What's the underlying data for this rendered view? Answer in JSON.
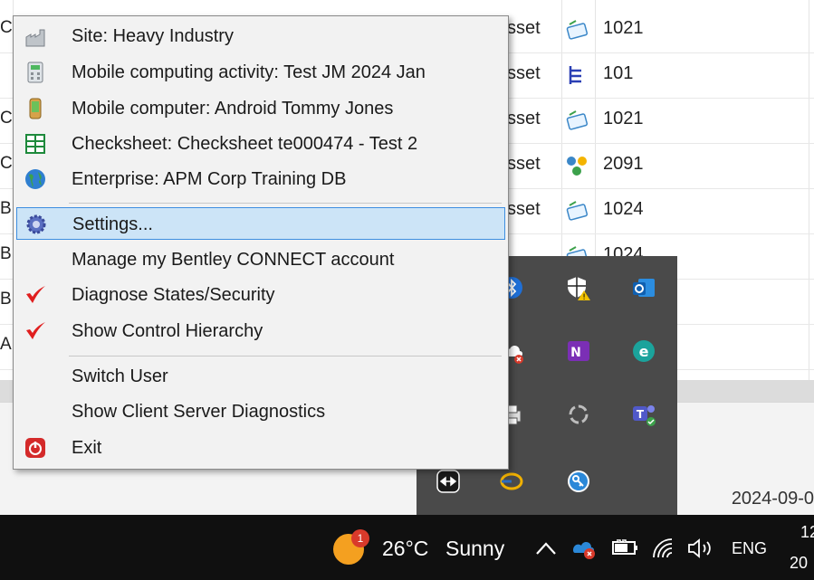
{
  "background_rows": [
    {
      "col0": "CO",
      "col2": "sset",
      "icon": "document-icon",
      "num": "1021"
    },
    {
      "col0": "",
      "col2": "sset",
      "icon": "hierarchy-icon",
      "num": "101"
    },
    {
      "col0": "CO",
      "col2": "sset",
      "icon": "document-icon",
      "num": "1021"
    },
    {
      "col0": "CO",
      "col2": "sset",
      "icon": "network-icon",
      "num": "2091"
    },
    {
      "col0": "BI",
      "col2": "sset",
      "icon": "document-icon",
      "num": "1024"
    },
    {
      "col0": "BI",
      "col2": "",
      "icon": "document-icon",
      "num": "1024"
    },
    {
      "col0": "BI",
      "col2": "",
      "icon": "",
      "num": ""
    },
    {
      "col0": "AL",
      "col2": "",
      "icon": "",
      "num": ""
    }
  ],
  "status_date": "2024-09-0",
  "menu": {
    "items": [
      {
        "label": "Site: Heavy Industry",
        "icon": "factory-icon"
      },
      {
        "label": "Mobile computing activity: Test JM 2024 Jan",
        "icon": "calculator-icon"
      },
      {
        "label": "Mobile computer: Android Tommy Jones",
        "icon": "mobile-device-icon"
      },
      {
        "label": "Checksheet: Checksheet  te000474 - Test 2",
        "icon": "grid-icon"
      },
      {
        "label": "Enterprise: APM  Corp Training DB",
        "icon": "globe-icon"
      },
      {
        "label": "Settings...",
        "icon": "gear-icon"
      },
      {
        "label": "Manage my Bentley CONNECT account",
        "icon": ""
      },
      {
        "label": "Diagnose States/Security",
        "icon": "check-mark-icon"
      },
      {
        "label": "Show Control Hierarchy",
        "icon": "check-mark-icon"
      },
      {
        "label": "Switch User",
        "icon": ""
      },
      {
        "label": "Show Client Server Diagnostics",
        "icon": ""
      },
      {
        "label": "Exit",
        "icon": "power-icon"
      }
    ],
    "highlighted_index": 5
  },
  "taskbar": {
    "weather_badge": "1",
    "temperature": "26°C",
    "condition": "Sunny",
    "language": "ENG",
    "clock_time": "12",
    "clock_date": "20"
  },
  "tray_icons": [
    "bluetooth-icon",
    "windows-security-icon",
    "outlook-icon",
    "onedrive-error-icon",
    "onenote-icon",
    "edge-icon",
    "printer-icon",
    "recycle-icon",
    "teams-icon",
    "teamviewer-icon",
    "sync-icon",
    "key-icon"
  ],
  "colors": {
    "menu_bg": "#f2f2f2",
    "highlight_bg": "#cce4f7",
    "highlight_border": "#3d8ee0",
    "taskbar_bg": "#101010",
    "tray_bg": "#4a4a4a"
  }
}
